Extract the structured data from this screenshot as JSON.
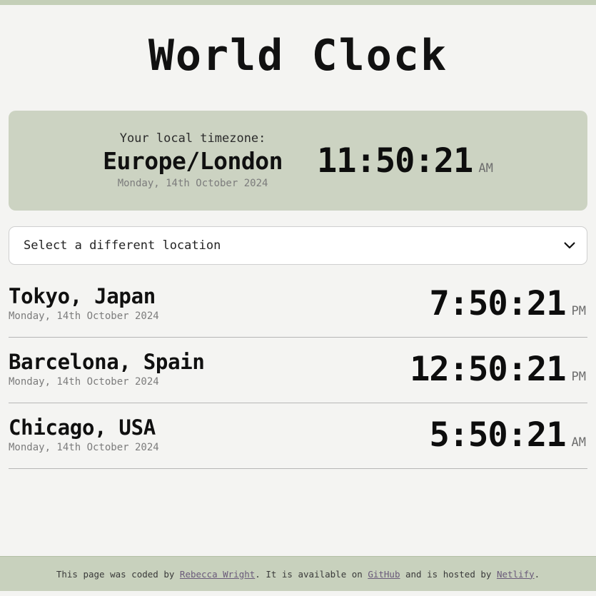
{
  "header": {
    "title": "World Clock"
  },
  "local": {
    "label": "Your local timezone:",
    "timezone": "Europe/London",
    "date": "Monday, 14th October 2024",
    "time": "11:50:21",
    "meridiem": "AM"
  },
  "selector": {
    "placeholder": "Select a different location",
    "selected": "Select a different location",
    "options": [
      "Select a different location"
    ],
    "icon": "chevron-down-icon"
  },
  "cities": [
    {
      "name": "Tokyo, Japan",
      "date": "Monday, 14th October 2024",
      "time": "7:50:21",
      "meridiem": "PM"
    },
    {
      "name": "Barcelona, Spain",
      "date": "Monday, 14th October 2024",
      "time": "12:50:21",
      "meridiem": "PM"
    },
    {
      "name": "Chicago, USA",
      "date": "Monday, 14th October 2024",
      "time": "5:50:21",
      "meridiem": "AM"
    }
  ],
  "footer": {
    "part1": "This page was coded by ",
    "link1": "Rebecca Wright",
    "part2": ". It is available on ",
    "link2": "GitHub",
    "part3": " and is hosted by ",
    "link3": "Netlify",
    "part4": "."
  },
  "colors": {
    "page_background": "#f4f4f2",
    "accent_sage": "#c4cfb8",
    "card_sage": "#ccd3c2",
    "footer_sage": "#c8d1bd",
    "text_primary": "#101010",
    "text_muted": "#7c7c7c",
    "link": "#6a5a7a",
    "divider": "#b6b6b6"
  }
}
